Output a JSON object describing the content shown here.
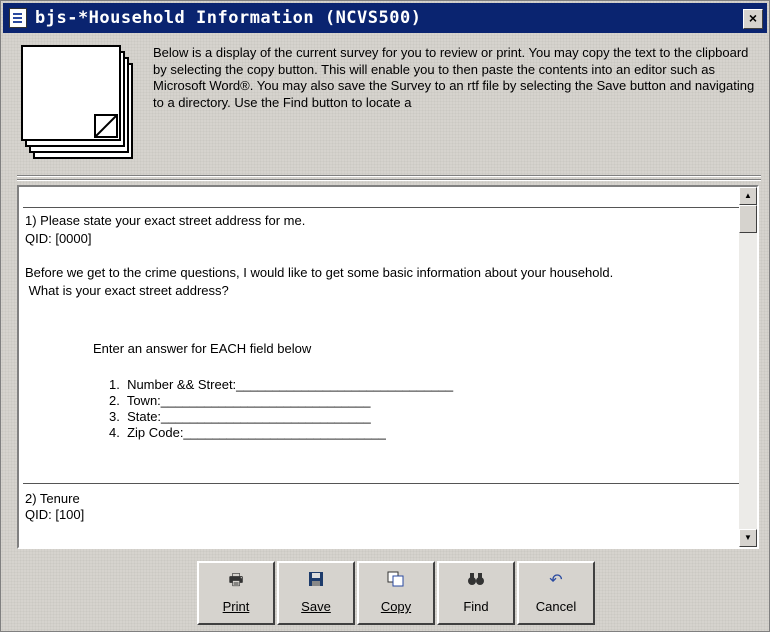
{
  "window": {
    "title": "bjs-*Household Information (NCVS500)"
  },
  "header": {
    "description": "Below is a display of the current survey for you to review or print.  You may copy the text to the clipboard by selecting the copy button.  This will enable you to then paste the contents into an editor such as Microsoft Word®.  You may also save the Survey to an rtf file by selecting the Save button and navigating to a directory. Use the Find button to locate a"
  },
  "survey": {
    "q1_title": "1) Please state your exact street address for me.",
    "q1_qid": "QID: [0000]",
    "q1_text_line1": "Before we get to the crime questions, I would like to get some basic information about your household.",
    "q1_text_line2": " What is your exact street address?",
    "instruction": "Enter an answer for EACH field below",
    "fields": [
      "1.  Number && Street:______________________________",
      "2.  Town:_____________________________",
      "3.  State:_____________________________",
      "4.  Zip Code:____________________________"
    ],
    "q2_title": "2) Tenure",
    "q2_qid": "QID: [100]"
  },
  "buttons": {
    "print": "Print",
    "save": "Save",
    "copy": "Copy",
    "find": "Find",
    "cancel": "Cancel"
  },
  "icons": {
    "print": "printer-icon",
    "save": "floppy-disk-icon",
    "copy": "copy-icon",
    "find": "binoculars-icon",
    "cancel": "undo-icon"
  }
}
